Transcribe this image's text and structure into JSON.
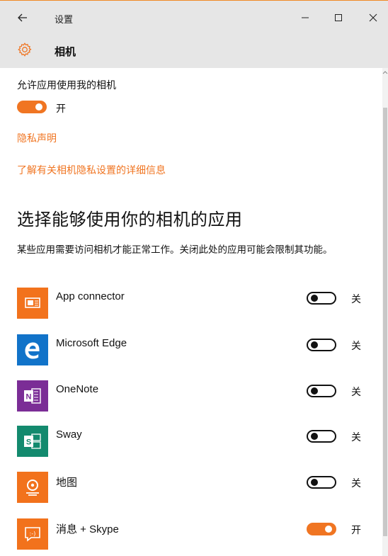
{
  "window": {
    "title": "设置",
    "controls": {
      "minimize": "–",
      "maximize": "☐",
      "close": "✕"
    }
  },
  "header": {
    "title": "相机",
    "icon": "gear-icon"
  },
  "settings": {
    "allow_label": "允许应用使用我的相机",
    "allow_toggle": {
      "on": true,
      "state_label": "开"
    },
    "privacy_link": "隐私声明",
    "learn_more_link": "了解有关相机隐私设置的详细信息"
  },
  "apps_section": {
    "title": "选择能够使用你的相机的应用",
    "description": "某些应用需要访问相机才能正常工作。关闭此处的应用可能会限制其功能。",
    "apps": [
      {
        "name": "App connector",
        "state_label": "关",
        "on": false,
        "icon": "app-connector-icon",
        "color": "#f2721c"
      },
      {
        "name": "Microsoft Edge",
        "state_label": "关",
        "on": false,
        "icon": "edge-icon",
        "color": "#1173c9"
      },
      {
        "name": "OneNote",
        "state_label": "关",
        "on": false,
        "icon": "onenote-icon",
        "color": "#7b2d96"
      },
      {
        "name": "Sway",
        "state_label": "关",
        "on": false,
        "icon": "sway-icon",
        "color": "#138a6e"
      },
      {
        "name": "地图",
        "state_label": "关",
        "on": false,
        "icon": "maps-icon",
        "color": "#f2721c"
      },
      {
        "name": "消息 + Skype",
        "state_label": "开",
        "on": true,
        "icon": "messaging-skype-icon",
        "color": "#f2721c"
      }
    ]
  },
  "colors": {
    "accent": "#f07522",
    "header_bg": "#e6e6e6"
  }
}
